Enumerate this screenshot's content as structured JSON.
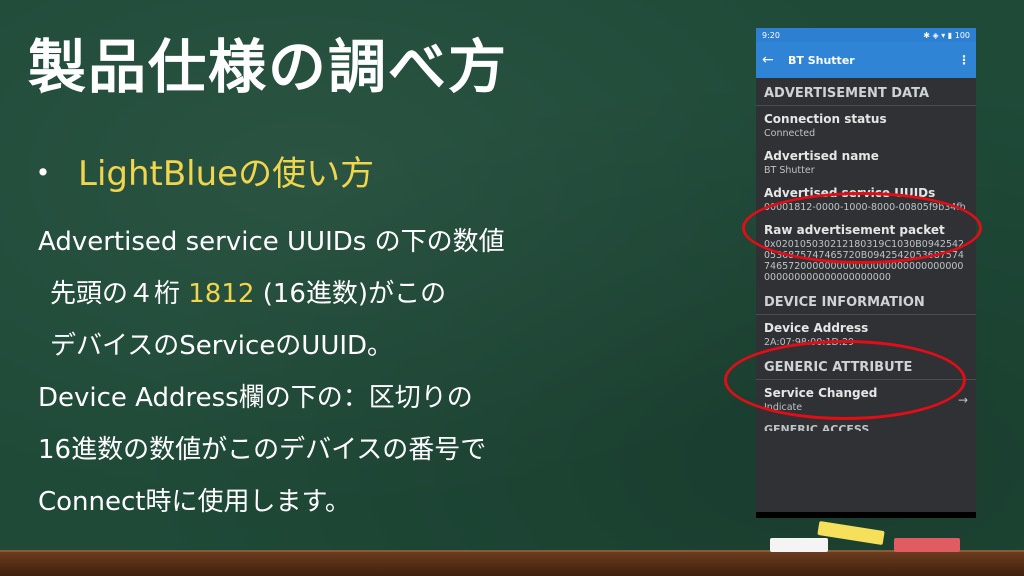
{
  "slide": {
    "title": "製品仕様の調べ方",
    "bullet_symbol": "・",
    "bullet_text": "LightBlueの使い方",
    "lines": [
      "Advertised service UUIDs の下の数値",
      "先頭の４桁 ",
      "1812",
      " (16進数)がこの",
      "デバイスのServiceのUUID。",
      "Device Address欄の下の：区切りの",
      "16進数の数値がこのデバイスの番号で",
      "Connect時に使用します。"
    ]
  },
  "phone": {
    "status_time": "9:20",
    "status_icons": "✱ ◈ ▾ ▮ 100",
    "back_glyph": "←",
    "app_title": "BT Shutter",
    "menu_glyph": "⋮",
    "section_advertisement": "ADVERTISEMENT DATA",
    "connection_status_label": "Connection status",
    "connection_status_value": "Connected",
    "advertised_name_label": "Advertised name",
    "advertised_name_value": "BT Shutter",
    "service_uuids_label": "Advertised service UUIDs",
    "service_uuids_value": "00001812-0000-1000-8000-00805f9b34fb",
    "raw_packet_label": "Raw advertisement packet",
    "raw_packet_value": "0x020105030212180319C1030B09425420536875747465720B0942542053687574746572000000000000000000000000000000000000000000000000",
    "section_device_info": "DEVICE INFORMATION",
    "device_address_label": "Device Address",
    "device_address_value": "2A:07:98:00:1D:29",
    "section_generic_attribute": "GENERIC ATTRIBUTE",
    "service_changed_label": "Service Changed",
    "service_changed_value": "Indicate",
    "arrow_glyph": "→",
    "section_generic_access": "GENERIC ACCESS"
  }
}
